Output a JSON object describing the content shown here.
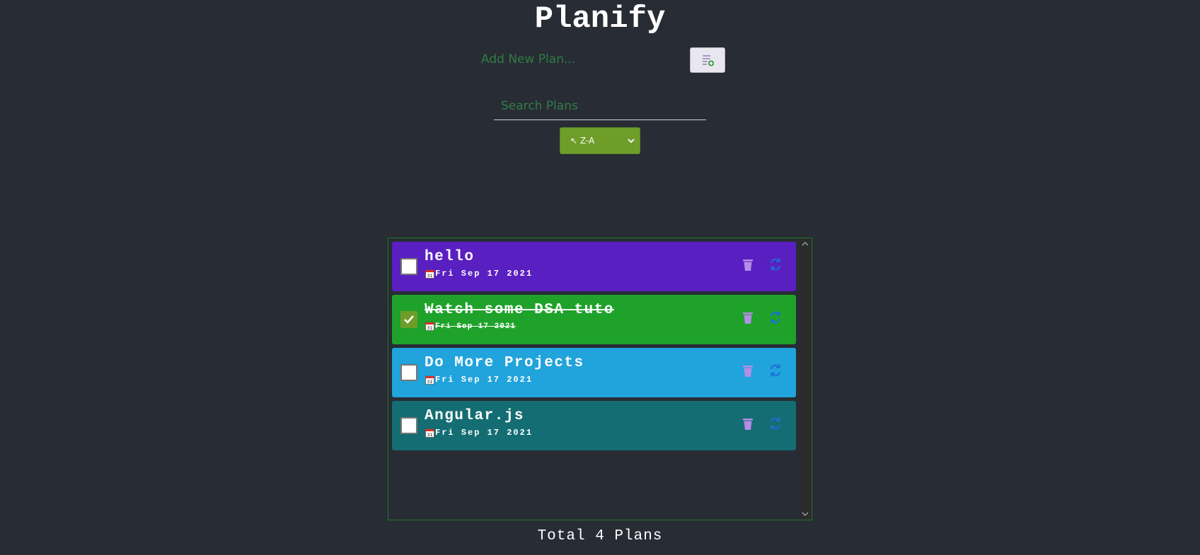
{
  "app": {
    "title": "Planify"
  },
  "new_plan": {
    "placeholder": "Add New Plan...",
    "add_button_icon": "add-list-icon"
  },
  "search": {
    "placeholder": "Search Plans"
  },
  "sort": {
    "selected_label": "↖ Z-A"
  },
  "plans": [
    {
      "title": "hello",
      "date": "Fri Sep 17 2021",
      "completed": false,
      "color": "#5a1fc0"
    },
    {
      "title": "Watch some DSA tuto",
      "date": "Fri Sep 17 2021",
      "completed": true,
      "color": "#1ea22a"
    },
    {
      "title": "Do More Projects",
      "date": "Fri Sep 17 2021",
      "completed": false,
      "color": "#21a3db"
    },
    {
      "title": "Angular.js",
      "date": "Fri Sep 17 2021",
      "completed": false,
      "color": "#146d73"
    }
  ],
  "footer": {
    "total_text": "Total 4 Plans"
  },
  "colors": {
    "background": "#282c34",
    "accent_green": "#6f9d2a",
    "list_border": "#1f7a26",
    "trash_icon": "#b48ee6",
    "edit_icon": "#1a6fd6"
  }
}
